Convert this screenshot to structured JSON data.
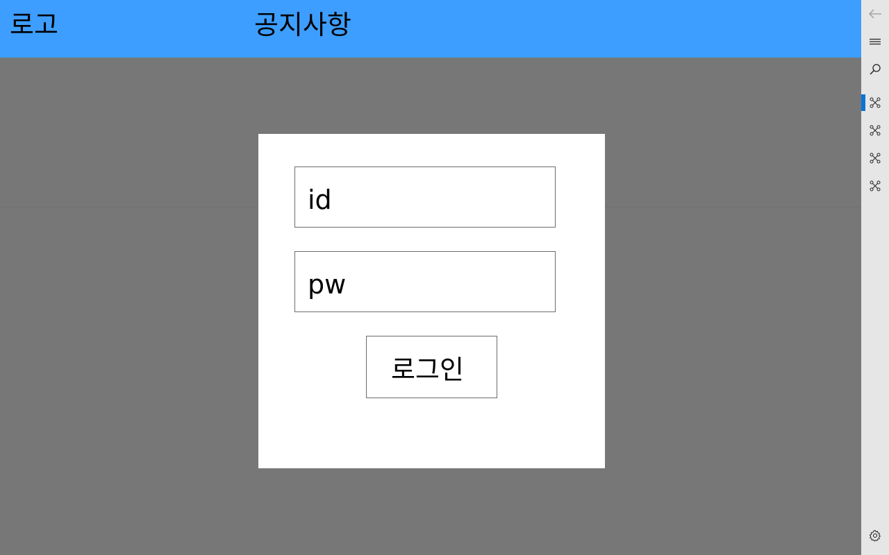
{
  "header": {
    "logo_text": "로고",
    "nav_notice": "공지사항",
    "background_color": "#3d9eff"
  },
  "login_dialog": {
    "id_placeholder": "id",
    "pw_placeholder": "pw",
    "login_button": "로그인"
  },
  "nav_rail": {
    "items": [
      {
        "icon": "back-arrow-icon"
      },
      {
        "icon": "hamburger-menu-icon"
      },
      {
        "icon": "search-icon"
      },
      {
        "icon": "node-graph-icon",
        "selected": true
      },
      {
        "icon": "node-graph-icon"
      },
      {
        "icon": "node-graph-icon"
      },
      {
        "icon": "node-graph-icon"
      },
      {
        "icon": "gear-icon"
      }
    ],
    "accent_color": "#0a74d6"
  },
  "colors": {
    "page_background": "#777777",
    "dialog_background": "#ffffff",
    "rail_background": "#e6e6e6"
  }
}
